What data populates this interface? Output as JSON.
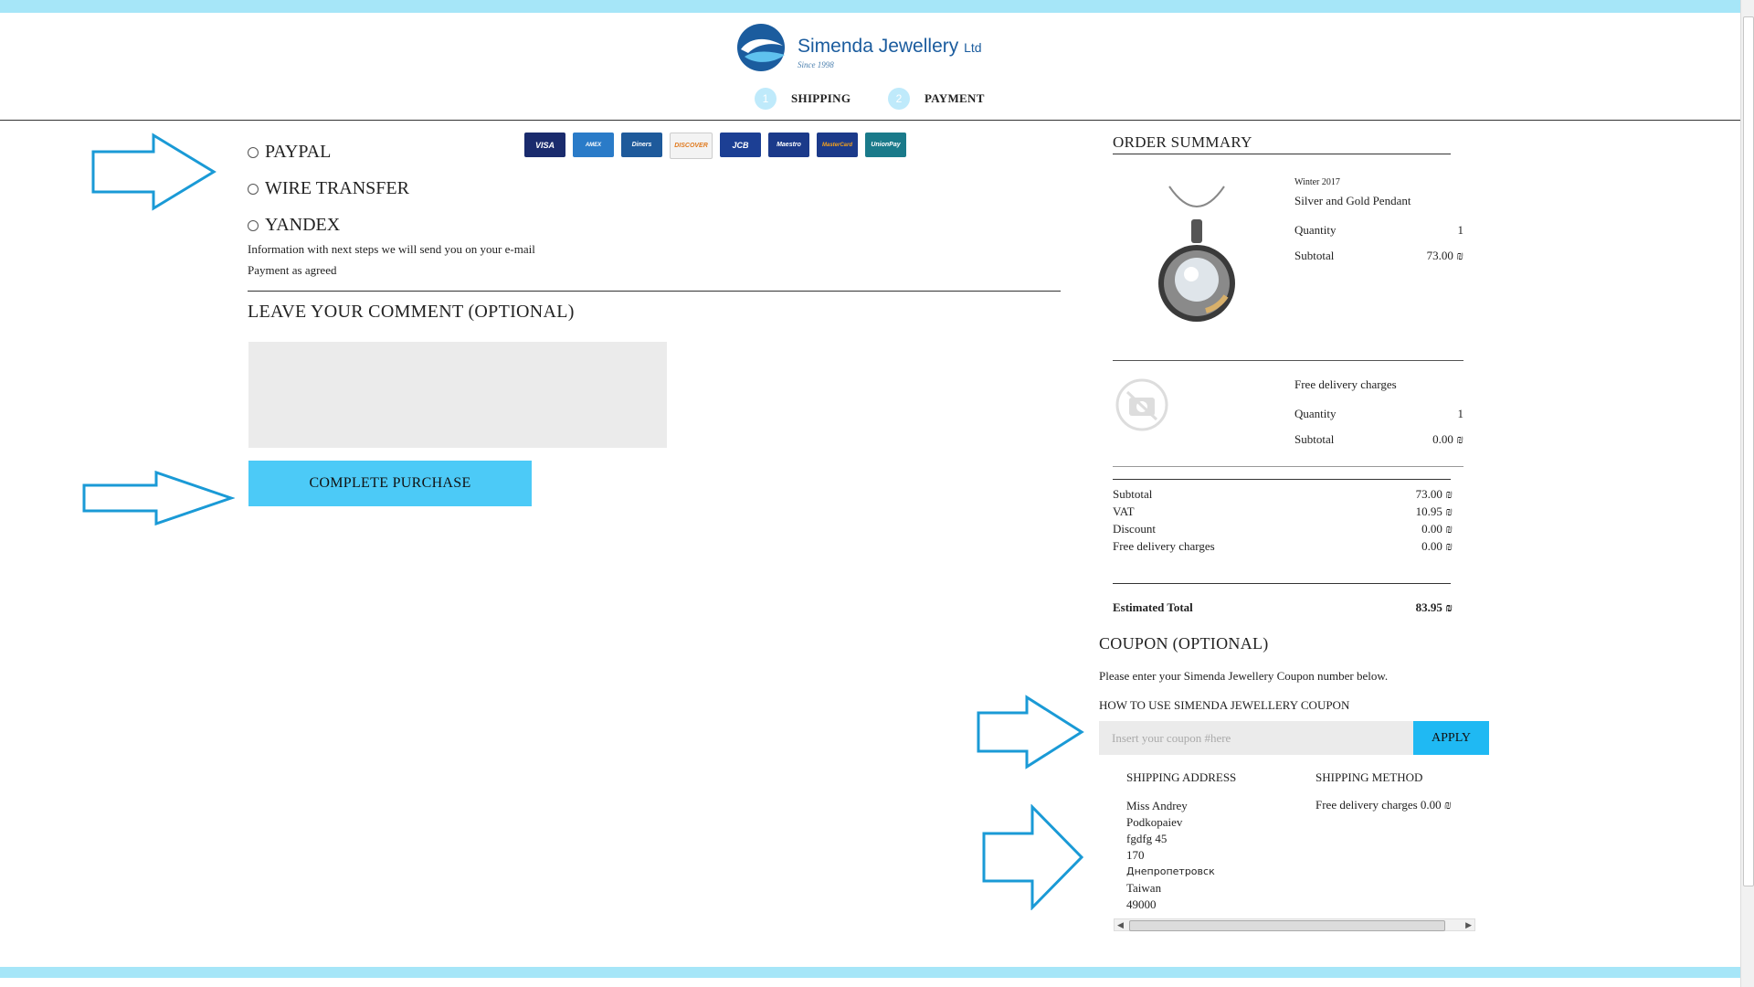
{
  "brand": {
    "name": "Simenda Jewellery",
    "suffix": "Ltd",
    "since": "Since 1998"
  },
  "steps": [
    {
      "num": "1",
      "label": "SHIPPING"
    },
    {
      "num": "2",
      "label": "PAYMENT"
    }
  ],
  "payment": {
    "options": [
      "PAYPAL",
      "WIRE TRANSFER",
      "YANDEX"
    ],
    "info_line1": "Information with next steps we will send you on your e-mail",
    "info_line2": "Payment as agreed",
    "cards": [
      {
        "name": "VISA",
        "color": "#1a2b6d"
      },
      {
        "name": "AMEX",
        "color": "#2a7bc8"
      },
      {
        "name": "Diners",
        "color": "#1e5a9b"
      },
      {
        "name": "DISCOVER",
        "color": "#f3f3f3"
      },
      {
        "name": "JCB",
        "color": "#1c3f94"
      },
      {
        "name": "Maestro",
        "color": "#1b3a8a"
      },
      {
        "name": "MasterCard",
        "color": "#1b3a8a"
      },
      {
        "name": "UnionPay",
        "color": "#1a7a8a"
      }
    ]
  },
  "comment": {
    "title": "LEAVE YOUR COMMENT (OPTIONAL)"
  },
  "complete_label": "COMPLETE PURCHASE",
  "summary": {
    "title": "ORDER SUMMARY",
    "item1": {
      "collection": "Winter 2017",
      "name": "Silver and Gold Pendant",
      "qty_label": "Quantity",
      "qty": "1",
      "sub_label": "Subtotal",
      "sub": "73.00 ₪"
    },
    "item2": {
      "name": "Free delivery charges",
      "qty_label": "Quantity",
      "qty": "1",
      "sub_label": "Subtotal",
      "sub": "0.00 ₪"
    },
    "totals": [
      {
        "label": "Subtotal",
        "value": "73.00 ₪"
      },
      {
        "label": "VAT",
        "value": "10.95 ₪"
      },
      {
        "label": "Discount",
        "value": "0.00 ₪"
      },
      {
        "label": "Free delivery charges",
        "value": "0.00 ₪"
      }
    ],
    "estimated_label": "Estimated Total",
    "estimated_value": "83.95 ₪"
  },
  "coupon": {
    "title": "COUPON (OPTIONAL)",
    "desc": "Please enter your Simenda Jewellery Coupon number below.",
    "howto": "HOW TO USE SIMENDA JEWELLERY COUPON",
    "placeholder": "Insert your coupon #here",
    "apply": "APPLY"
  },
  "shipping": {
    "address_title": "SHIPPING ADDRESS",
    "address_lines": [
      "Miss Andrey",
      "Podkopaiev",
      "fgdfg 45",
      "170",
      "Днепропетровск",
      "Taiwan",
      "49000"
    ],
    "method_title": "SHIPPING METHOD",
    "method": "Free delivery charges 0.00 ₪"
  },
  "colors": {
    "accent": "#4ccaf7",
    "apply": "#1fb9f3",
    "arrow": "#1a9ad6",
    "bar": "#a6e6f8"
  }
}
